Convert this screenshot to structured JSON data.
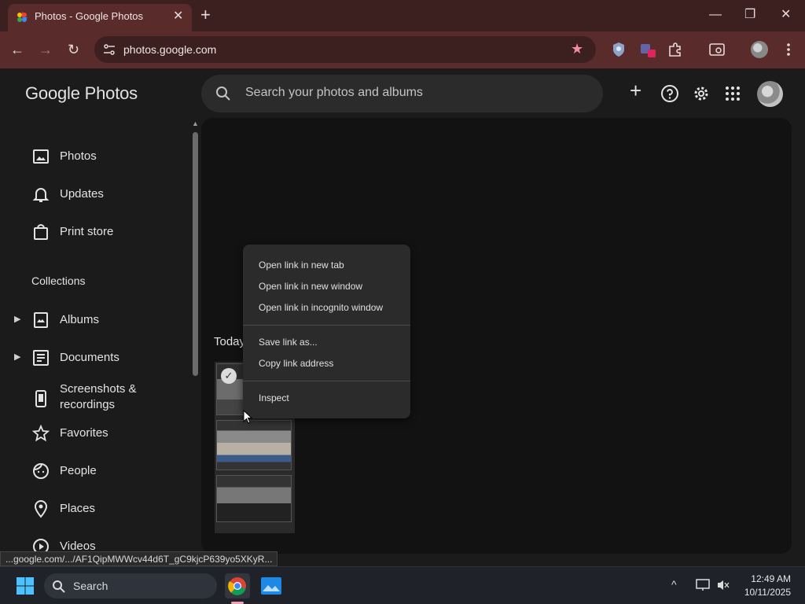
{
  "browser": {
    "tab_title": "Photos - Google Photos",
    "tab_close_glyph": "✕",
    "new_tab_glyph": "+",
    "window_controls": {
      "minimize": "—",
      "restore": "❐",
      "close": "✕"
    },
    "nav": {
      "back": "←",
      "forward": "→",
      "reload": "↻"
    },
    "url": "photos.google.com",
    "bookmark_star": "★",
    "accent": "#5a2b2b"
  },
  "app": {
    "logo": "Google Photos",
    "search_placeholder": "Search your photos and albums",
    "add_glyph": "+"
  },
  "sidebar": {
    "items": [
      {
        "label": "Photos",
        "icon": "photo-icon"
      },
      {
        "label": "Updates",
        "icon": "bell-icon"
      },
      {
        "label": "Print store",
        "icon": "shopping-bag-icon"
      }
    ],
    "collections_heading": "Collections",
    "collections": [
      {
        "label": "Albums",
        "icon": "album-icon",
        "expandable": true
      },
      {
        "label": "Documents",
        "icon": "document-icon",
        "expandable": true
      },
      {
        "label": "Screenshots & recordings",
        "icon": "phone-icon",
        "expandable": false
      },
      {
        "label": "Favorites",
        "icon": "star-icon",
        "expandable": false
      },
      {
        "label": "People",
        "icon": "face-icon",
        "expandable": false
      },
      {
        "label": "Places",
        "icon": "location-pin-icon",
        "expandable": false
      },
      {
        "label": "Videos",
        "icon": "video-icon",
        "expandable": false
      }
    ],
    "expand_glyph": "▶"
  },
  "main": {
    "section_title": "Today",
    "check_glyph": "✓"
  },
  "context_menu": {
    "groups": [
      [
        "Open link in new tab",
        "Open link in new window",
        "Open link in incognito window"
      ],
      [
        "Save link as...",
        "Copy link address"
      ],
      [
        "Inspect"
      ]
    ]
  },
  "status_bar": {
    "url": "...google.com/.../AF1QipMWWcv44d6T_gC9kjcP639yo5XKyR..."
  },
  "taskbar": {
    "search_label": "Search",
    "time": "12:49 AM",
    "date": "10/11/2025",
    "tray_caret": "^"
  }
}
